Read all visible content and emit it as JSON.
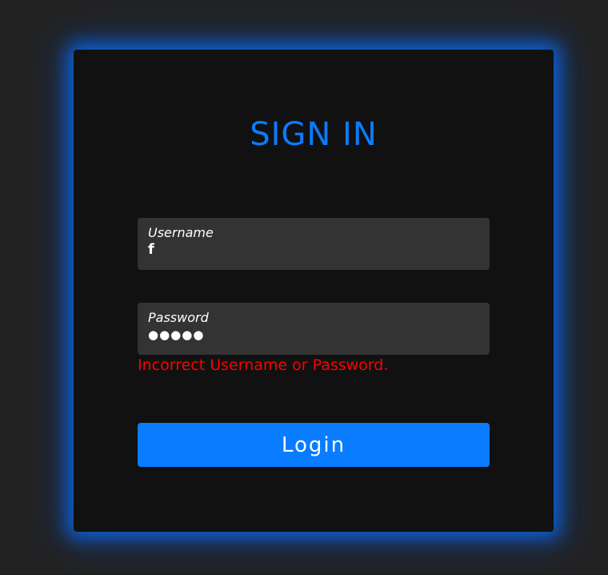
{
  "form": {
    "title": "SIGN IN",
    "username": {
      "label": "Username",
      "value": "f"
    },
    "password": {
      "label": "Password",
      "masked_value": "●●●●●"
    },
    "error_message": "Incorrect Username or Password.",
    "login_label": "Login"
  },
  "colors": {
    "accent": "#0a7cff",
    "error": "#ff0000",
    "card_background": "#111111",
    "page_background": "#222222",
    "field_background": "#333333"
  }
}
